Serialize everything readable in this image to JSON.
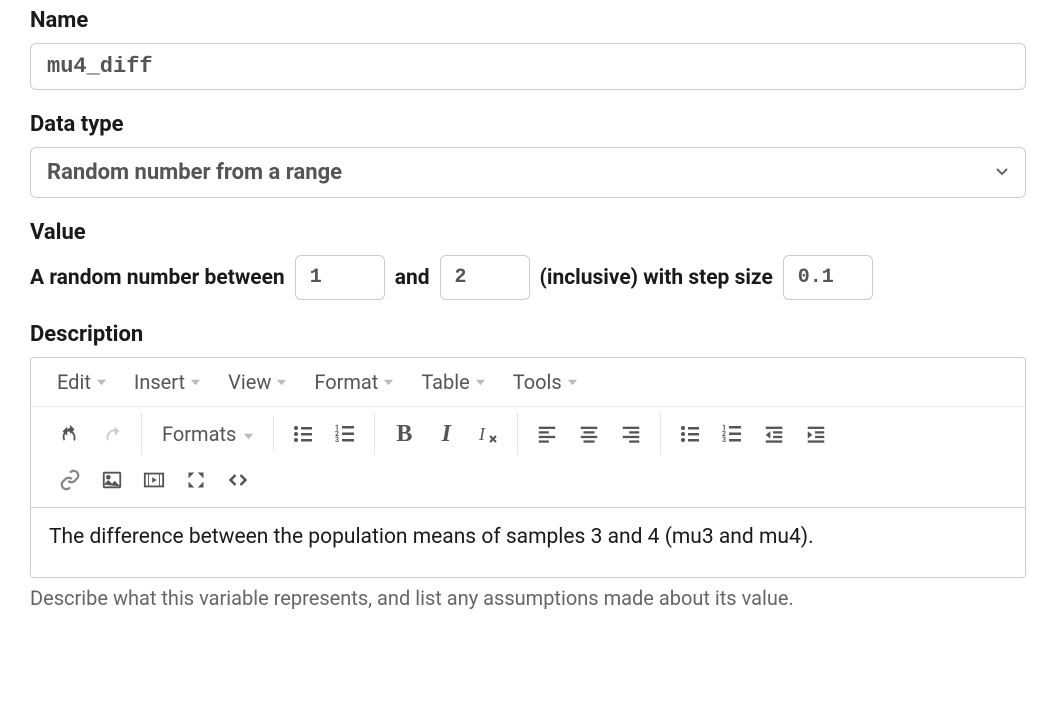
{
  "name": {
    "label": "Name",
    "value": "mu4_diff"
  },
  "dataType": {
    "label": "Data type",
    "selected": "Random number from a range"
  },
  "value": {
    "label": "Value",
    "text_before": "A random number between",
    "min": "1",
    "text_and": "and",
    "max": "2",
    "text_inclusive": "(inclusive) with step size",
    "step": "0.1"
  },
  "description": {
    "label": "Description",
    "content": "The difference between the population means of samples 3 and 4 (mu3 and mu4).",
    "help": "Describe what this variable represents, and list any assumptions made about its value."
  },
  "editor": {
    "menus": {
      "edit": "Edit",
      "insert": "Insert",
      "view": "View",
      "format": "Format",
      "table": "Table",
      "tools": "Tools"
    },
    "formats": "Formats"
  }
}
